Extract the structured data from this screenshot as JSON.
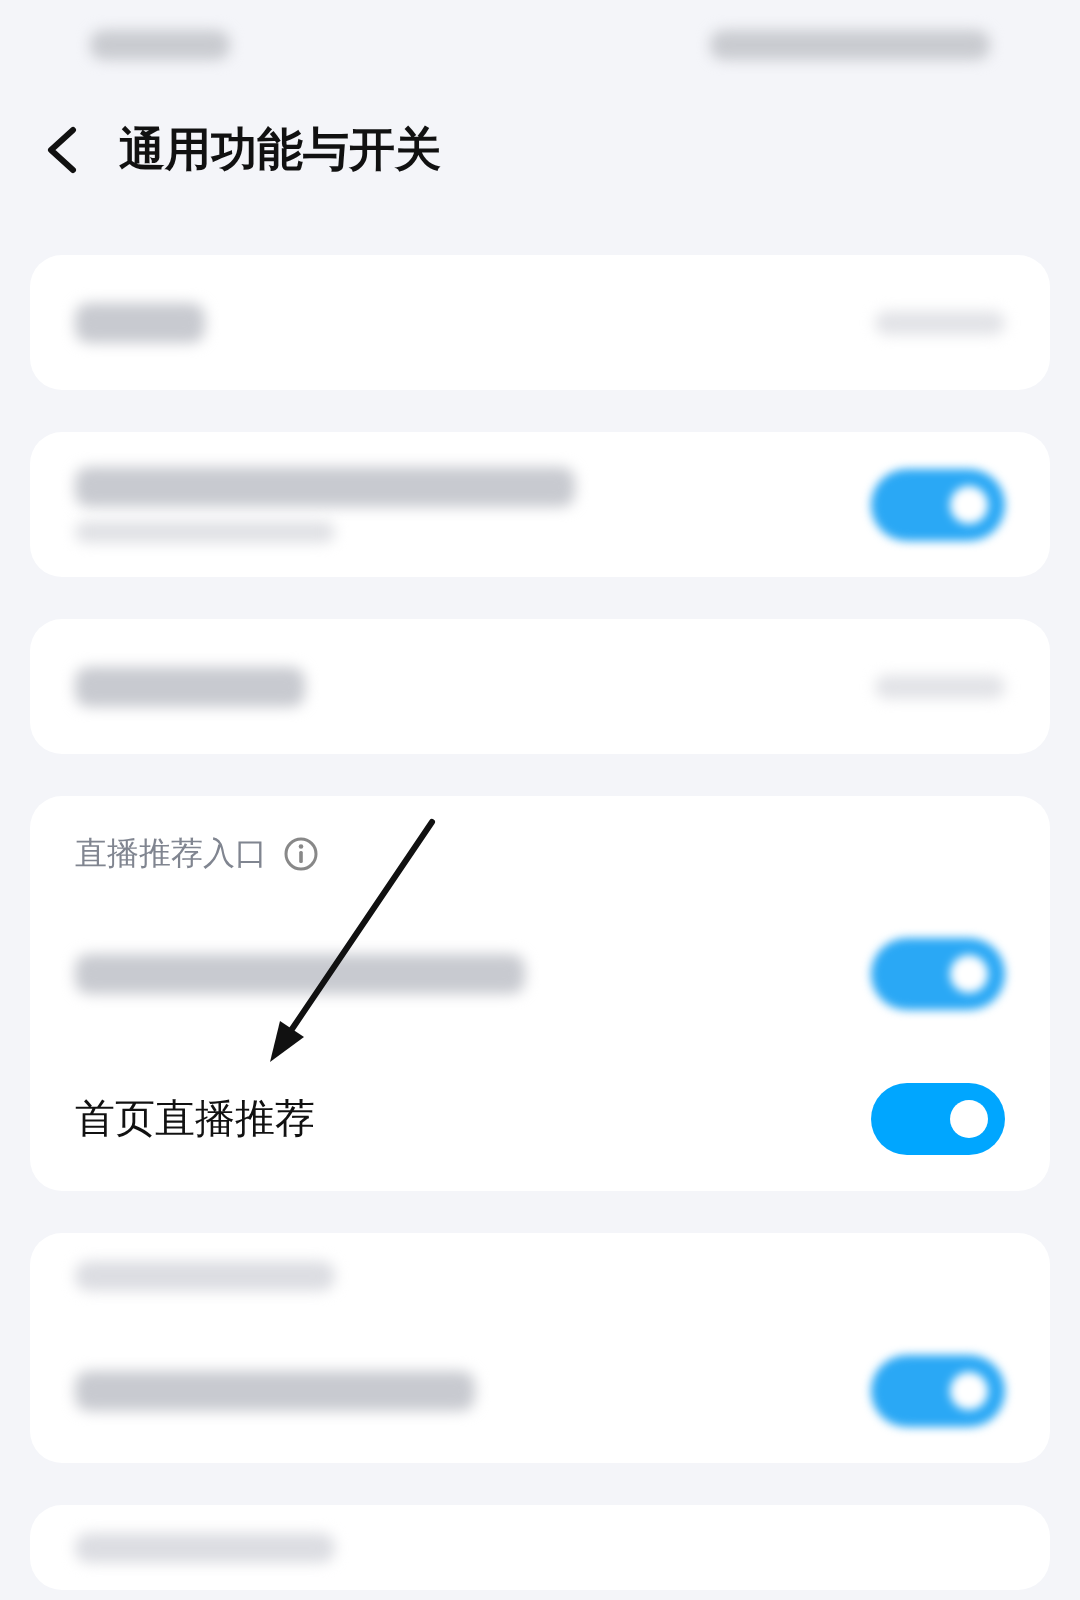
{
  "header": {
    "title": "通用功能与开关"
  },
  "cards": [
    {
      "items": [
        {
          "kind": "blurred_link"
        }
      ]
    },
    {
      "items": [
        {
          "kind": "blurred_toggle_sub",
          "on": true
        }
      ]
    },
    {
      "items": [
        {
          "kind": "blurred_link"
        }
      ]
    },
    {
      "items": [
        {
          "kind": "section_header",
          "text": "直播推荐入口"
        },
        {
          "kind": "blurred_toggle",
          "on": true
        },
        {
          "kind": "toggle",
          "label": "首页直播推荐",
          "on": true
        }
      ]
    },
    {
      "items": [
        {
          "kind": "blurred_header"
        },
        {
          "kind": "blurred_toggle",
          "on": true
        }
      ]
    },
    {
      "items": [
        {
          "kind": "blurred_header"
        }
      ]
    }
  ]
}
